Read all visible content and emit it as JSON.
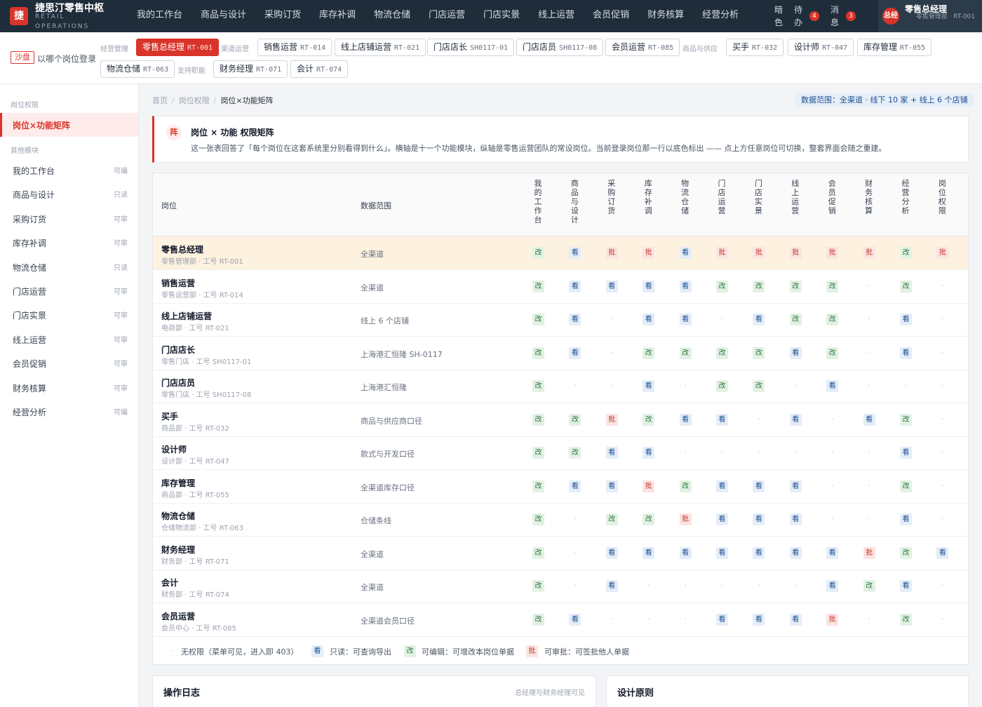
{
  "brand": {
    "logo": "捷",
    "name": "捷思汀零售中枢",
    "sub": "RETAIL OPERATIONS"
  },
  "nav": [
    "我的工作台",
    "商品与设计",
    "采购订货",
    "库存补调",
    "物流仓储",
    "门店运营",
    "门店实景",
    "线上运营",
    "会员促销",
    "财务核算",
    "经营分析"
  ],
  "tools": {
    "theme": "暗色",
    "todo": "待办",
    "todo_count": "4",
    "msg": "消息",
    "msg_count": "3"
  },
  "user": {
    "avatar": "总经",
    "name": "零售总经理",
    "dept": "零售管理部 · RT-001"
  },
  "rolebar": {
    "sandbox": "沙盘",
    "hint": "以哪个岗位登录",
    "groups": [
      {
        "label": "经营管理"
      },
      {
        "label": "渠道运营"
      },
      {
        "label": "商品与供应"
      },
      {
        "label": "支持职能"
      }
    ],
    "roles": [
      {
        "name": "零售总经理",
        "code": "RT-001"
      },
      {
        "name": "销售运营",
        "code": "RT-014"
      },
      {
        "name": "线上店铺运营",
        "code": "RT-021"
      },
      {
        "name": "门店店长",
        "code": "SH0117-01"
      },
      {
        "name": "门店店员",
        "code": "SH0117-08"
      },
      {
        "name": "会员运营",
        "code": "RT-085"
      },
      {
        "name": "买手",
        "code": "RT-032"
      },
      {
        "name": "设计师",
        "code": "RT-047"
      },
      {
        "name": "库存管理",
        "code": "RT-055"
      },
      {
        "name": "物流仓储",
        "code": "RT-063"
      },
      {
        "name": "财务经理",
        "code": "RT-071"
      },
      {
        "name": "会计",
        "code": "RT-074"
      }
    ]
  },
  "sidebar": {
    "section1": "岗位权限",
    "active": "岗位×功能矩阵",
    "section2": "其他模块",
    "items": [
      {
        "label": "我的工作台",
        "perm": "可编"
      },
      {
        "label": "商品与设计",
        "perm": "只读"
      },
      {
        "label": "采购订货",
        "perm": "可审"
      },
      {
        "label": "库存补调",
        "perm": "可审"
      },
      {
        "label": "物流仓储",
        "perm": "只读"
      },
      {
        "label": "门店运营",
        "perm": "可审"
      },
      {
        "label": "门店实景",
        "perm": "可审"
      },
      {
        "label": "线上运营",
        "perm": "可审"
      },
      {
        "label": "会员促销",
        "perm": "可审"
      },
      {
        "label": "财务核算",
        "perm": "可审"
      },
      {
        "label": "经营分析",
        "perm": "可编"
      }
    ]
  },
  "breadcrumb": [
    "首页",
    "岗位权限",
    "岗位×功能矩阵"
  ],
  "scope_badge": "数据范围：全渠道 · 线下 10 家 + 线上 6 个店铺",
  "intro": {
    "icon": "阵",
    "title": "岗位 × 功能 权限矩阵",
    "text": "这一张表回答了「每个岗位在这套系统里分别看得到什么」。横轴是十一个功能模块，纵轴是零售运营团队的常设岗位。当前登录岗位那一行以底色标出 —— 点上方任意岗位可切换，整套界面会随之重建。"
  },
  "matrix": {
    "head_role": "岗位",
    "head_scope": "数据范围",
    "columns": [
      "我的工作台",
      "商品与设计",
      "采购订货",
      "库存补调",
      "物流仓储",
      "门店运营",
      "门店实景",
      "线上运营",
      "会员促销",
      "财务核算",
      "经营分析",
      "岗位权限"
    ],
    "levels": {
      "edit": "改",
      "read": "看",
      "approve": "批",
      "none": "·"
    },
    "rows": [
      {
        "title": "零售总经理",
        "sub": "零售管理部 · 工号 RT-001",
        "scope": "全渠道",
        "current": true,
        "cells": [
          "edit",
          "read",
          "approve",
          "approve",
          "read",
          "approve",
          "approve",
          "approve",
          "approve",
          "approve",
          "edit",
          "approve"
        ]
      },
      {
        "title": "销售运营",
        "sub": "零售运营部 · 工号 RT-014",
        "scope": "全渠道",
        "cells": [
          "edit",
          "read",
          "read",
          "read",
          "read",
          "edit",
          "edit",
          "edit",
          "edit",
          "none",
          "edit",
          "none"
        ]
      },
      {
        "title": "线上店铺运营",
        "sub": "电商部 · 工号 RT-021",
        "scope": "线上 6 个店铺",
        "cells": [
          "edit",
          "read",
          "none",
          "read",
          "read",
          "none",
          "read",
          "edit",
          "edit",
          "none",
          "read",
          "none"
        ]
      },
      {
        "title": "门店店长",
        "sub": "零售门店 · 工号 SH0117-01",
        "scope": "上海港汇恒隆 SH-0117",
        "cells": [
          "edit",
          "read",
          "none",
          "edit",
          "edit",
          "edit",
          "edit",
          "read",
          "edit",
          "none",
          "read",
          "none"
        ]
      },
      {
        "title": "门店店员",
        "sub": "零售门店 · 工号 SH0117-08",
        "scope": "上海港汇恒隆",
        "cells": [
          "edit",
          "none",
          "none",
          "read",
          "none",
          "edit",
          "edit",
          "none",
          "read",
          "none",
          "none",
          "none"
        ]
      },
      {
        "title": "买手",
        "sub": "商品部 · 工号 RT-032",
        "scope": "商品与供应商口径",
        "cells": [
          "edit",
          "edit",
          "approve",
          "edit",
          "read",
          "read",
          "none",
          "read",
          "none",
          "read",
          "edit",
          "none"
        ]
      },
      {
        "title": "设计师",
        "sub": "设计部 · 工号 RT-047",
        "scope": "款式与开发口径",
        "cells": [
          "edit",
          "edit",
          "read",
          "read",
          "none",
          "none",
          "none",
          "none",
          "none",
          "none",
          "read",
          "none"
        ]
      },
      {
        "title": "库存管理",
        "sub": "商品部 · 工号 RT-055",
        "scope": "全渠道库存口径",
        "cells": [
          "edit",
          "read",
          "read",
          "approve",
          "edit",
          "read",
          "read",
          "read",
          "none",
          "none",
          "edit",
          "none"
        ]
      },
      {
        "title": "物流仓储",
        "sub": "仓储物流部 · 工号 RT-063",
        "scope": "仓储条线",
        "cells": [
          "edit",
          "none",
          "edit",
          "edit",
          "approve",
          "read",
          "read",
          "read",
          "none",
          "none",
          "read",
          "none"
        ]
      },
      {
        "title": "财务经理",
        "sub": "财务部 · 工号 RT-071",
        "scope": "全渠道",
        "cells": [
          "edit",
          "none",
          "read",
          "read",
          "read",
          "read",
          "read",
          "read",
          "read",
          "approve",
          "edit",
          "read"
        ]
      },
      {
        "title": "会计",
        "sub": "财务部 · 工号 RT-074",
        "scope": "全渠道",
        "cells": [
          "edit",
          "none",
          "read",
          "none",
          "none",
          "none",
          "none",
          "none",
          "read",
          "edit",
          "read",
          "none"
        ]
      },
      {
        "title": "会员运营",
        "sub": "会员中心 · 工号 RT-085",
        "scope": "全渠道会员口径",
        "cells": [
          "edit",
          "read",
          "none",
          "none",
          "none",
          "read",
          "read",
          "read",
          "approve",
          "none",
          "edit",
          "none"
        ]
      }
    ],
    "legend": [
      {
        "level": "none",
        "text": "无权限（菜单可见，进入即 403）"
      },
      {
        "level": "read",
        "text": "只读：可查询导出"
      },
      {
        "level": "edit",
        "text": "可编辑：可增改本岗位单据"
      },
      {
        "level": "approve",
        "text": "可审批：可签批他人单据"
      }
    ]
  },
  "cards": [
    {
      "title": "操作日志",
      "note": "总经理与财务经理可见"
    },
    {
      "title": "设计原则"
    }
  ],
  "colors": {
    "brand": "#d9342b",
    "topbar": "#1f2d3a",
    "edit": "#2f7a3d",
    "read": "#1d4f91",
    "approve": "#c2352b"
  }
}
